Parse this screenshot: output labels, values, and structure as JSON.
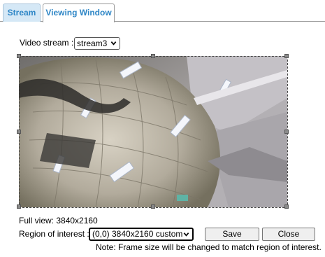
{
  "tabs": [
    {
      "label": "Stream",
      "active": false
    },
    {
      "label": "Viewing Window",
      "active": true
    }
  ],
  "stream": {
    "label": "Video stream :",
    "selected": "stream3"
  },
  "viewer": {
    "full_view": "Full view: 3840x2160"
  },
  "roi": {
    "label": "Region of interest :",
    "selected": "(0,0) 3840x2160 custom"
  },
  "buttons": {
    "save": "Save",
    "close": "Close"
  },
  "note": "Note: Frame size will be changed to match region of interest.",
  "colors": {
    "tab_text": "#2e86c6",
    "tab_active_bg": "#d5e8f6"
  }
}
